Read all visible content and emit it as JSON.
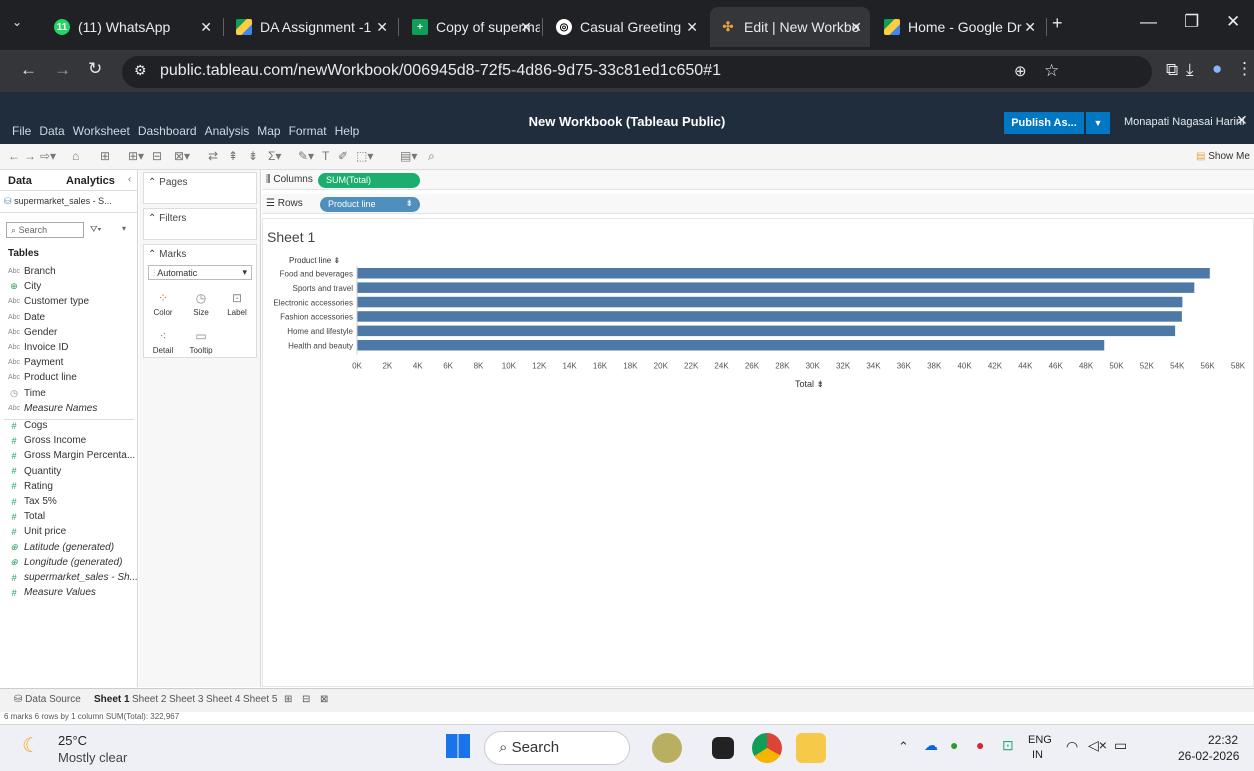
{
  "browser": {
    "tabs": [
      {
        "label": "(11) WhatsApp",
        "badge": "11"
      },
      {
        "label": "DA Assignment -1"
      },
      {
        "label": "Copy of supermar"
      },
      {
        "label": "Casual Greeting"
      },
      {
        "label": "Edit | New Workbo"
      },
      {
        "label": "Home - Google Dr"
      }
    ],
    "url": "public.tableau.com/newWorkbook/006945d8-72f5-4d86-9d75-33c81ed1c650#1"
  },
  "tableau": {
    "title": "New Workbook (Tableau Public)",
    "menu": [
      "File",
      "Data",
      "Worksheet",
      "Dashboard",
      "Analysis",
      "Map",
      "Format",
      "Help"
    ],
    "publish_label": "Publish As...",
    "user": "Monapati Nagasai Harini",
    "show_me": "Show Me",
    "data_tab": "Data",
    "analytics_tab": "Analytics",
    "datasource": "supermarket_sales - S...",
    "search_placeholder": "Search",
    "tables_label": "Tables",
    "fields": [
      {
        "name": "Branch",
        "icon": "Abc"
      },
      {
        "name": "City",
        "icon": "globe"
      },
      {
        "name": "Customer type",
        "icon": "Abc"
      },
      {
        "name": "Date",
        "icon": "Abc"
      },
      {
        "name": "Gender",
        "icon": "Abc"
      },
      {
        "name": "Invoice ID",
        "icon": "Abc"
      },
      {
        "name": "Payment",
        "icon": "Abc"
      },
      {
        "name": "Product line",
        "icon": "Abc"
      },
      {
        "name": "Time",
        "icon": "clock"
      },
      {
        "name": "Measure Names",
        "icon": "Abc",
        "italic": true
      }
    ],
    "measures": [
      {
        "name": "Cogs",
        "icon": "#"
      },
      {
        "name": "Gross Income",
        "icon": "#"
      },
      {
        "name": "Gross Margin Percenta...",
        "icon": "#"
      },
      {
        "name": "Quantity",
        "icon": "#"
      },
      {
        "name": "Rating",
        "icon": "#"
      },
      {
        "name": "Tax 5%",
        "icon": "#"
      },
      {
        "name": "Total",
        "icon": "#"
      },
      {
        "name": "Unit price",
        "icon": "#"
      },
      {
        "name": "Latitude (generated)",
        "icon": "globe",
        "italic": true
      },
      {
        "name": "Longitude (generated)",
        "icon": "globe",
        "italic": true
      },
      {
        "name": "supermarket_sales - Sh...",
        "icon": "#",
        "italic": true
      },
      {
        "name": "Measure Values",
        "icon": "#",
        "italic": true
      }
    ],
    "pages_label": "Pages",
    "filters_label": "Filters",
    "marks_label": "Marks",
    "mark_type": "Automatic",
    "mark_buttons": [
      "Color",
      "Size",
      "Label",
      "Detail",
      "Tooltip"
    ],
    "columns_label": "Columns",
    "columns_pill": "SUM(Total)",
    "rows_label": "Rows",
    "rows_pill": "Product line",
    "sheet_title": "Sheet 1",
    "row_header": "Product line",
    "sheet_tabs": [
      "Data Source",
      "Sheet 1",
      "Sheet 2",
      "Sheet 3",
      "Sheet 4",
      "Sheet 5"
    ],
    "status": "6 marks   6 rows by 1 column   SUM(Total): 322,967"
  },
  "chart_data": {
    "type": "bar",
    "orientation": "horizontal",
    "categories": [
      "Food and beverages",
      "Sports and travel",
      "Electronic accessories",
      "Fashion accessories",
      "Home and lifestyle",
      "Health and beauty"
    ],
    "values": [
      56145,
      55123,
      54338,
      54306,
      53862,
      49194
    ],
    "xlabel": "Total",
    "ylabel": "Product line",
    "xlim": [
      0,
      58000
    ],
    "xticks": [
      "0K",
      "2K",
      "4K",
      "6K",
      "8K",
      "10K",
      "12K",
      "14K",
      "16K",
      "18K",
      "20K",
      "22K",
      "24K",
      "26K",
      "28K",
      "30K",
      "32K",
      "34K",
      "36K",
      "38K",
      "40K",
      "42K",
      "44K",
      "46K",
      "48K",
      "50K",
      "52K",
      "54K",
      "56K",
      "58K"
    ],
    "bar_color": "#4e79a7"
  },
  "taskbar": {
    "temp": "25°C",
    "weather": "Mostly clear",
    "search_placeholder": "Search",
    "lang_top": "ENG",
    "lang_bottom": "IN",
    "time": "22:32",
    "date": "26-02-2026"
  }
}
